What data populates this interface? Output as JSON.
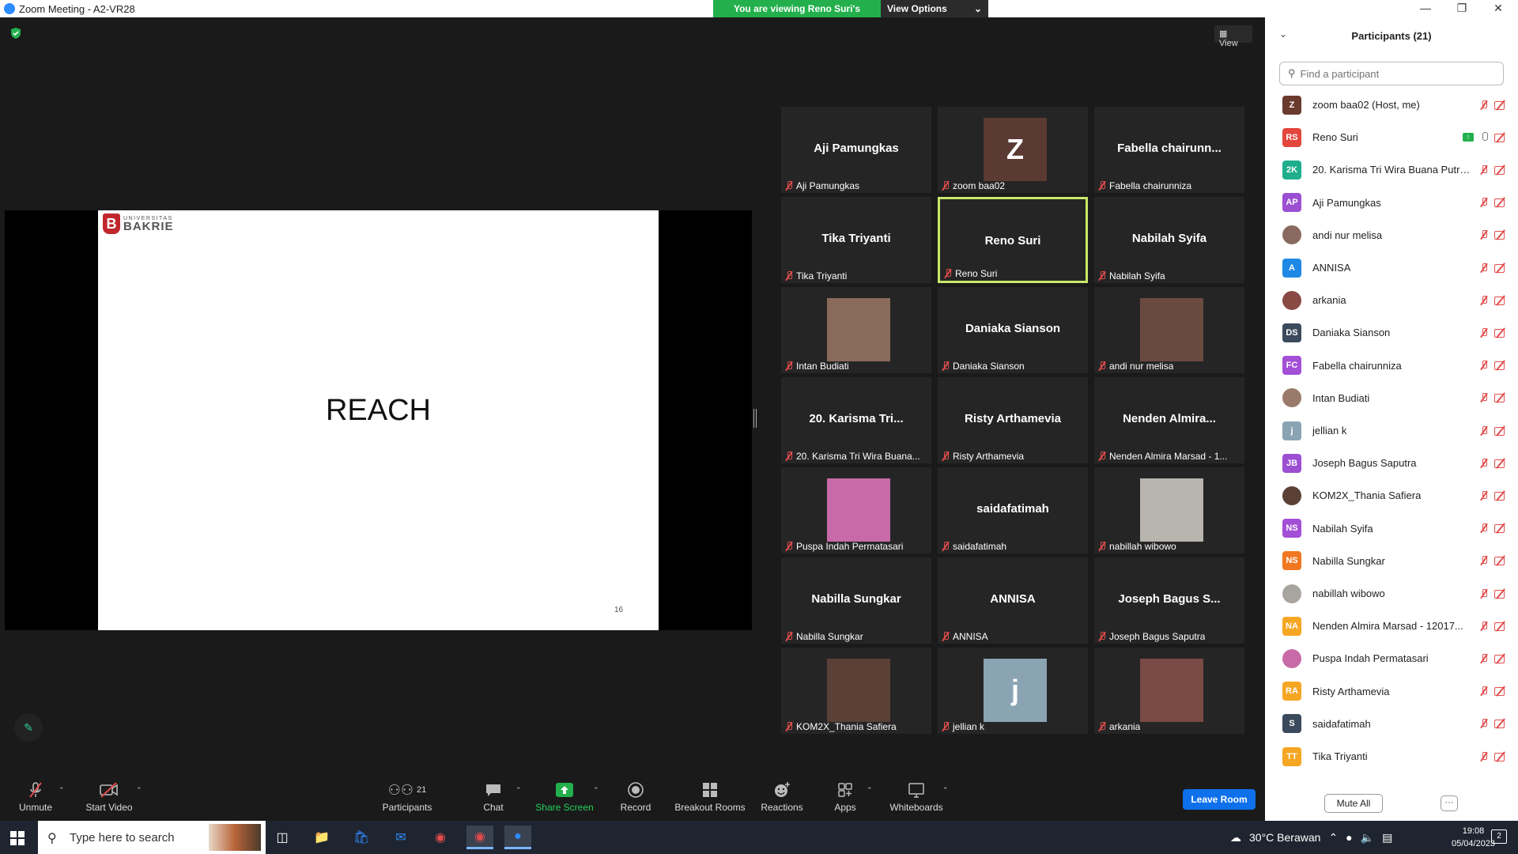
{
  "window": {
    "title": "Zoom Meeting - A2-VR28"
  },
  "banner": {
    "viewing": "You are viewing Reno Suri's screen",
    "view_options": "View Options"
  },
  "stage": {
    "view_label": "View"
  },
  "slide": {
    "logo_line1": "UNIVERSITAS",
    "logo_line2": "BAKRIE",
    "heading": "REACH",
    "page_number": "16"
  },
  "gallery": [
    {
      "name": "Aji Pamungkas",
      "label": "Aji Pamungkas",
      "type": "name"
    },
    {
      "name": "Z",
      "label": "zoom baa02",
      "type": "letter",
      "color": "#5a3a32"
    },
    {
      "name": "Fabella  chairunn...",
      "label": "Fabella chairunniza",
      "type": "name"
    },
    {
      "name": "Tika Triyanti",
      "label": "Tika Triyanti",
      "type": "name"
    },
    {
      "name": "Reno Suri",
      "label": "Reno Suri",
      "type": "name",
      "active": true
    },
    {
      "name": "Nabilah Syifa",
      "label": "Nabilah Syifa",
      "type": "name"
    },
    {
      "name": "",
      "label": "Intan Budiati",
      "type": "photo",
      "color": "#8a6a5a"
    },
    {
      "name": "Daniaka Sianson",
      "label": "Daniaka Sianson",
      "type": "name"
    },
    {
      "name": "",
      "label": "andi nur melisa",
      "type": "photo",
      "color": "#6a4a40"
    },
    {
      "name": "20. Karisma Tri...",
      "label": "20. Karisma Tri Wira Buana...",
      "type": "name"
    },
    {
      "name": "Risty Arthamevia",
      "label": "Risty Arthamevia",
      "type": "name"
    },
    {
      "name": "Nenden  Almira...",
      "label": "Nenden Almira Marsad - 1...",
      "type": "name"
    },
    {
      "name": "",
      "label": "Puspa Indah Permatasari",
      "type": "photo",
      "color": "#c86aa8"
    },
    {
      "name": "saidafatimah",
      "label": "saidafatimah",
      "type": "name"
    },
    {
      "name": "",
      "label": "nabillah wibowo",
      "type": "photo",
      "color": "#b8b4ae"
    },
    {
      "name": "Nabilla Sungkar",
      "label": "Nabilla Sungkar",
      "type": "name"
    },
    {
      "name": "ANNISA",
      "label": "ANNISA",
      "type": "name"
    },
    {
      "name": "Joseph Bagus S...",
      "label": "Joseph Bagus Saputra",
      "type": "name"
    },
    {
      "name": "",
      "label": "KOM2X_Thania Safiera",
      "type": "photo",
      "color": "#5a4036"
    },
    {
      "name": "j",
      "label": "jellian k",
      "type": "letter",
      "color": "#8aa4b4"
    },
    {
      "name": "",
      "label": "arkania",
      "type": "photo",
      "color": "#7a4a44"
    }
  ],
  "toolbar": {
    "unmute": "Unmute",
    "start_video": "Start Video",
    "participants": "Participants",
    "participants_count": "21",
    "chat": "Chat",
    "share_screen": "Share Screen",
    "record": "Record",
    "breakout": "Breakout Rooms",
    "reactions": "Reactions",
    "apps": "Apps",
    "whiteboards": "Whiteboards",
    "leave": "Leave Room"
  },
  "panel": {
    "title": "Participants (21)",
    "search_placeholder": "Find a participant",
    "mute_all": "Mute All",
    "more": "···",
    "participants": [
      {
        "initials": "Z",
        "name": "zoom baa02 (Host, me)",
        "color": "#6b3a2e"
      },
      {
        "initials": "RS",
        "name": "Reno Suri",
        "color": "#e2463c",
        "sharing": true
      },
      {
        "initials": "2K",
        "name": "20. Karisma Tri Wira Buana Putra...",
        "color": "#1fae8c"
      },
      {
        "initials": "AP",
        "name": "Aji Pamungkas",
        "color": "#9b4fd1"
      },
      {
        "initials": "",
        "name": "andi nur melisa",
        "color": "#8a6a60",
        "photo": true
      },
      {
        "initials": "A",
        "name": "ANNISA",
        "color": "#1e88e5"
      },
      {
        "initials": "",
        "name": "arkania",
        "color": "#8a4a44",
        "photo": true
      },
      {
        "initials": "DS",
        "name": "Daniaka Sianson",
        "color": "#3b4a5c"
      },
      {
        "initials": "FC",
        "name": "Fabella chairunniza",
        "color": "#a34fd6"
      },
      {
        "initials": "",
        "name": "Intan Budiati",
        "color": "#9a7a6a",
        "photo": true
      },
      {
        "initials": "j",
        "name": "jellian k",
        "color": "#8aa4b4"
      },
      {
        "initials": "JB",
        "name": "Joseph Bagus Saputra",
        "color": "#9b4fd1"
      },
      {
        "initials": "",
        "name": "KOM2X_Thania Safiera",
        "color": "#5a4036",
        "photo": true
      },
      {
        "initials": "NS",
        "name": "Nabilah Syifa",
        "color": "#a34fd6"
      },
      {
        "initials": "NS",
        "name": "Nabilla Sungkar",
        "color": "#f07820"
      },
      {
        "initials": "",
        "name": "nabillah wibowo",
        "color": "#a8a4a0",
        "photo": true
      },
      {
        "initials": "NA",
        "name": "Nenden Almira Marsad - 12017...",
        "color": "#f5a623"
      },
      {
        "initials": "",
        "name": "Puspa Indah Permatasari",
        "color": "#c86aa8",
        "photo": true
      },
      {
        "initials": "RA",
        "name": "Risty Arthamevia",
        "color": "#f5a623"
      },
      {
        "initials": "S",
        "name": "saidafatimah",
        "color": "#3b4a5c"
      },
      {
        "initials": "TT",
        "name": "Tika Triyanti",
        "color": "#f5a623"
      }
    ]
  },
  "taskbar": {
    "search_placeholder": "Type here to search",
    "weather": "30°C  Berawan",
    "time": "19:08",
    "date": "05/04/2023",
    "notifications": "2"
  }
}
